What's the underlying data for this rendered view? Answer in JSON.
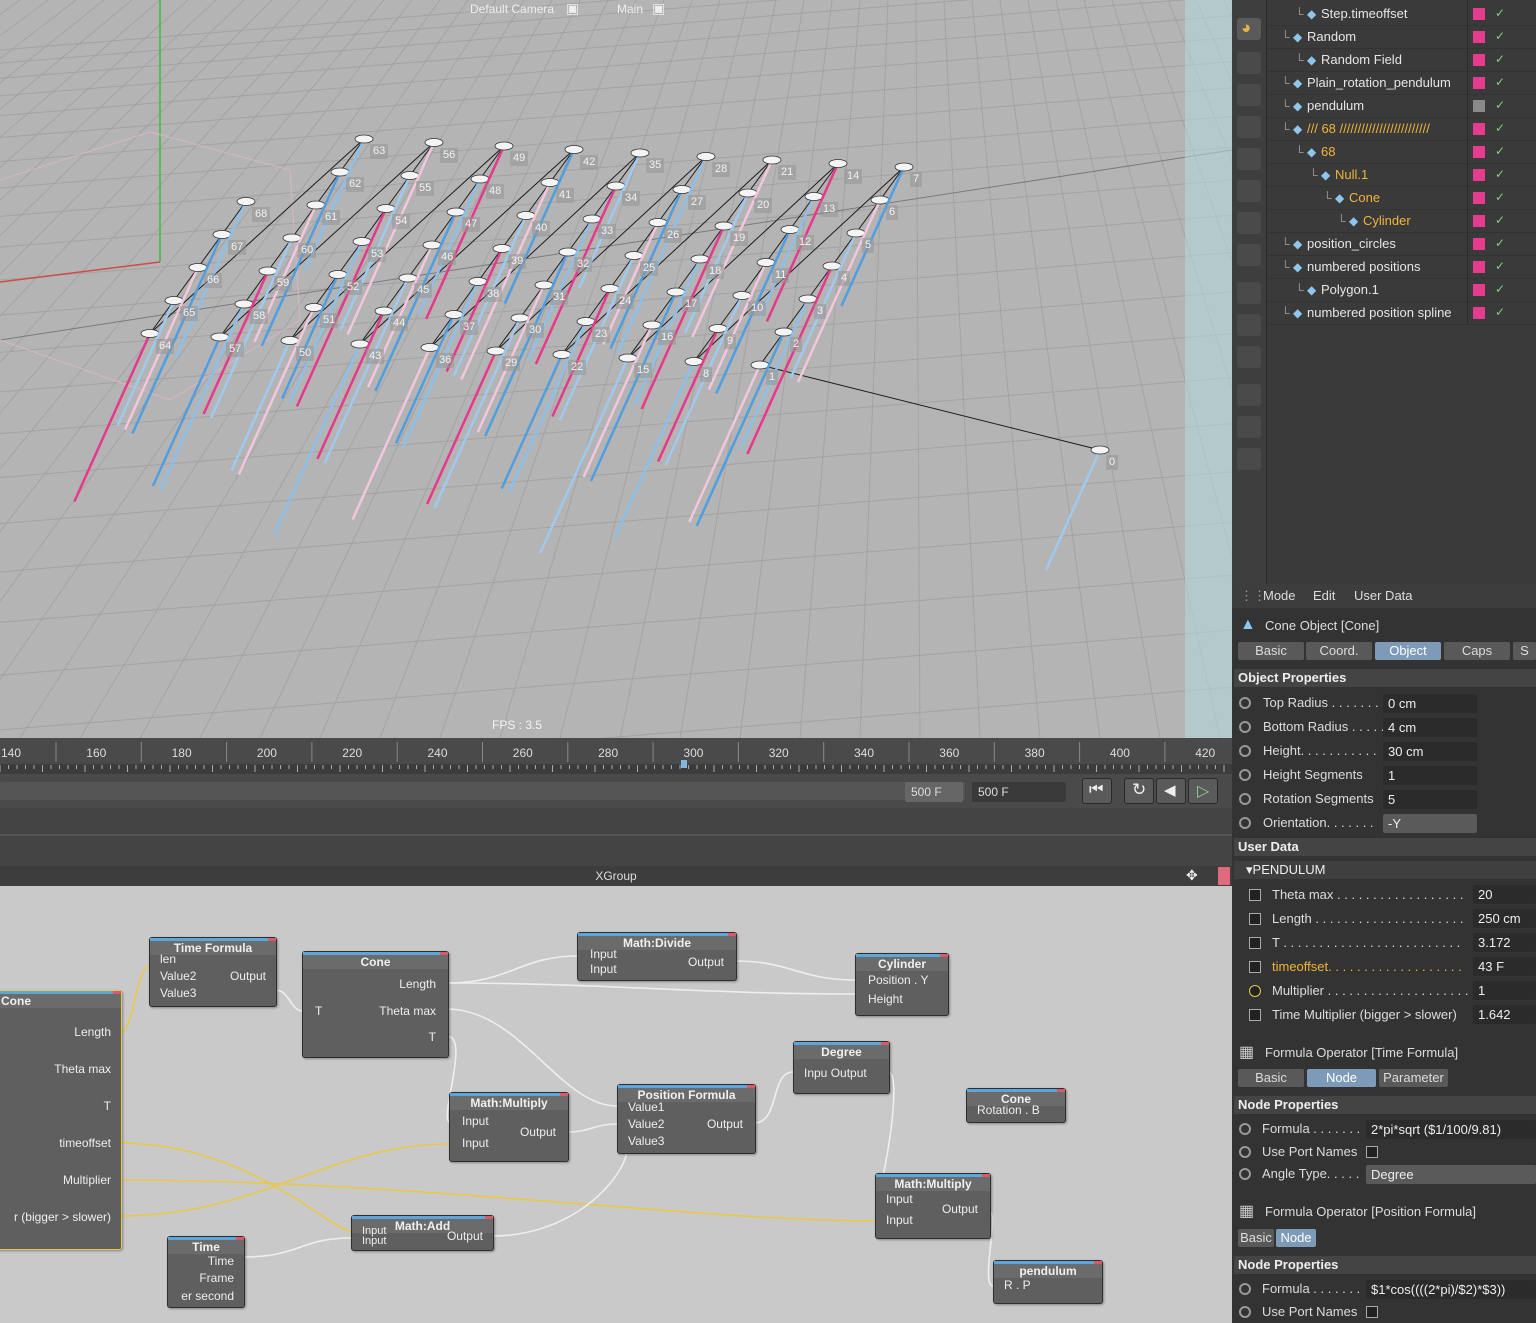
{
  "viewport": {
    "camera_label": "Default Camera",
    "render_label": "Main",
    "fps": "FPS : 3.5",
    "numbers": [
      "0",
      "1",
      "2",
      "3",
      "4",
      "5",
      "6",
      "7",
      "8",
      "9",
      "10",
      "11",
      "12",
      "13",
      "14",
      "15",
      "16",
      "17",
      "18",
      "19",
      "20",
      "21",
      "22",
      "23",
      "24",
      "25",
      "26",
      "27",
      "28",
      "29",
      "30",
      "31",
      "32",
      "33",
      "34",
      "35",
      "36",
      "37",
      "38",
      "39",
      "40",
      "41",
      "42",
      "43",
      "44",
      "45",
      "46",
      "47",
      "48",
      "49",
      "50",
      "51",
      "52",
      "53",
      "54",
      "55",
      "56",
      "57",
      "58",
      "59",
      "60",
      "61",
      "62",
      "63",
      "64",
      "65",
      "66",
      "67",
      "68"
    ]
  },
  "timeline": {
    "ticks": [
      "140",
      "160",
      "180",
      "200",
      "220",
      "240",
      "260",
      "280",
      "300",
      "320",
      "340",
      "360",
      "380",
      "400",
      "420"
    ],
    "frame_start": "500 F",
    "frame_end": "500 F"
  },
  "xpresso": {
    "title": "XGroup",
    "nodes": {
      "cone_main": {
        "title": "Cone",
        "ports": [
          "Length",
          "Theta max",
          "T",
          "timeoffset",
          "Multiplier",
          "r (bigger > slower)"
        ]
      },
      "time_formula": {
        "title": "Time Formula",
        "inputs": [
          "len",
          "Value2",
          "Value3"
        ],
        "output": "Output"
      },
      "cone2": {
        "title": "Cone",
        "in": "T",
        "outputs": [
          "Length",
          "Theta max",
          "T"
        ]
      },
      "math_divide": {
        "title": "Math:Divide",
        "inputs": [
          "Input",
          "Input"
        ],
        "output": "Output"
      },
      "cylinder": {
        "title": "Cylinder",
        "inputs": [
          "Position . Y",
          "Height"
        ]
      },
      "math_multiply1": {
        "title": "Math:Multiply",
        "inputs": [
          "Input",
          "Input"
        ],
        "output": "Output"
      },
      "position_formula": {
        "title": "Position Formula",
        "inputs": [
          "Value1",
          "Value2",
          "Value3"
        ],
        "output": "Output"
      },
      "degree": {
        "title": "Degree",
        "ports": "Inpu Output"
      },
      "cone3": {
        "title": "Cone",
        "in": "Rotation . B"
      },
      "math_multiply2": {
        "title": "Math:Multiply",
        "inputs": [
          "Input",
          "Input"
        ],
        "output": "Output"
      },
      "math_add": {
        "title": "Math:Add",
        "inputs": [
          "Input",
          "Input"
        ],
        "output": "Output"
      },
      "time": {
        "title": "Time",
        "outputs": [
          "Time",
          "Frame",
          "er second"
        ]
      },
      "pendulum": {
        "title": "pendulum",
        "in": "R . P"
      }
    }
  },
  "objects": [
    {
      "name": "Step.timeoffset",
      "indent": 1,
      "color": "pink"
    },
    {
      "name": "Random",
      "indent": 0,
      "color": "pink"
    },
    {
      "name": "Random Field",
      "indent": 1,
      "color": "pink"
    },
    {
      "name": "Plain_rotation_pendulum",
      "indent": 0,
      "color": "pink"
    },
    {
      "name": "pendulum",
      "indent": 0,
      "color": "gray"
    },
    {
      "name": "/// 68 /////////////////////////",
      "indent": 0,
      "color": "pink",
      "highlight": true
    },
    {
      "name": "68",
      "indent": 1,
      "color": "pink",
      "highlight": true
    },
    {
      "name": "Null.1",
      "indent": 2,
      "color": "pink",
      "highlight": true
    },
    {
      "name": "Cone",
      "indent": 3,
      "color": "pink",
      "highlight": true
    },
    {
      "name": "Cylinder",
      "indent": 4,
      "color": "pink",
      "highlight": true
    },
    {
      "name": "position_circles",
      "indent": 0,
      "color": "pink"
    },
    {
      "name": "numbered positions",
      "indent": 0,
      "color": "pink"
    },
    {
      "name": "Polygon.1",
      "indent": 1,
      "color": "pink"
    },
    {
      "name": "numbered position spline",
      "indent": 0,
      "color": "pink"
    }
  ],
  "attributes": {
    "menu": {
      "mode": "Mode",
      "edit": "Edit",
      "user_data": "User Data"
    },
    "object_title": "Cone Object [Cone]",
    "tabs": [
      "Basic",
      "Coord.",
      "Object",
      "Caps",
      "S"
    ],
    "object_properties": "Object Properties",
    "props": [
      {
        "label": "Top Radius . . . . . . .",
        "value": "0 cm"
      },
      {
        "label": "Bottom Radius . . . . .",
        "value": "4 cm"
      },
      {
        "label": "Height. . . . . . . . . . .",
        "value": "30 cm"
      },
      {
        "label": "Height Segments",
        "value": "1"
      },
      {
        "label": "Rotation Segments",
        "value": "5"
      },
      {
        "label": "Orientation. . . . . . .",
        "value": "-Y"
      }
    ],
    "user_data": "User Data",
    "group": "PENDULUM",
    "user_props": [
      {
        "label": "Theta max . . . . . . . . . . . . . . . . . . .",
        "value": "20"
      },
      {
        "label": "Length . . . . . . . . . . . . . . . . . . . . .",
        "value": "250 cm"
      },
      {
        "label": "T . . . . . . . . . . . . . . . . . . . . . . . . .",
        "value": "3.172"
      },
      {
        "label": "timeoffset. . . . . . . . . . . . . . . . . . .",
        "value": "43 F"
      },
      {
        "label": "Multiplier . . . . . . . . . . . . . . . . . . . .",
        "value": "1"
      },
      {
        "label": "Time Multiplier (bigger > slower)",
        "value": "1.642"
      }
    ],
    "formula1_title": "Formula Operator [Time Formula]",
    "formula1_tabs": [
      "Basic",
      "Node",
      "Parameter"
    ],
    "node_properties": "Node Properties",
    "formula1_props": [
      {
        "label": "Formula . . . . . . .",
        "value": "2*pi*sqrt ($1/100/9.81)"
      },
      {
        "label": "Use Port Names",
        "value": ""
      },
      {
        "label": "Angle Type. . . . .",
        "value": "Degree"
      }
    ],
    "formula2_title": "Formula Operator [Position Formula]",
    "formula2_tabs": [
      "Basic",
      "Node"
    ],
    "node_properties2": "Node Properties",
    "formula2_props": [
      {
        "label": "Formula . . . . . . .",
        "value": "$1*cos((((2*pi)/$2)*$3))"
      },
      {
        "label": "Use Port Names",
        "value": ""
      }
    ]
  }
}
